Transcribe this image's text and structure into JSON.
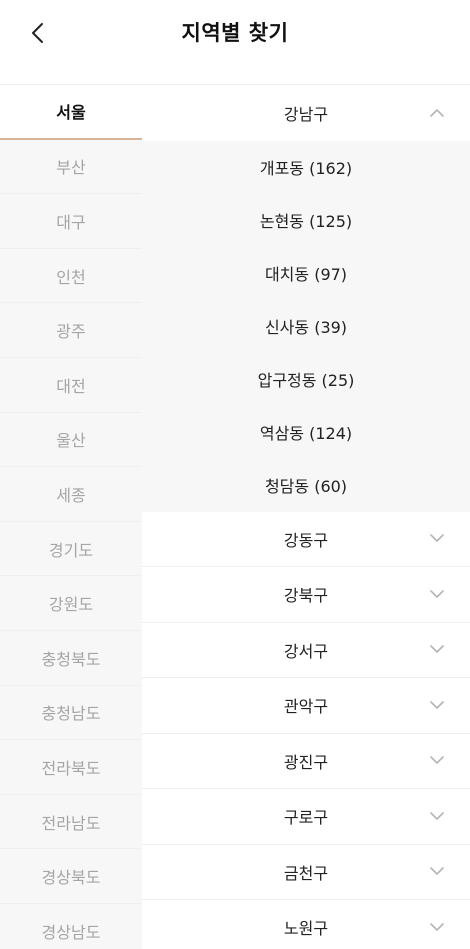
{
  "header": {
    "title": "지역별 찾기",
    "back_icon": "chevron-left-icon"
  },
  "regions": [
    {
      "label": "서울",
      "active": true
    },
    {
      "label": "부산"
    },
    {
      "label": "대구"
    },
    {
      "label": "인천"
    },
    {
      "label": "광주"
    },
    {
      "label": "대전"
    },
    {
      "label": "울산"
    },
    {
      "label": "세종"
    },
    {
      "label": "경기도"
    },
    {
      "label": "강원도"
    },
    {
      "label": "충청북도"
    },
    {
      "label": "충청남도"
    },
    {
      "label": "전라북도"
    },
    {
      "label": "전라남도"
    },
    {
      "label": "경상북도"
    },
    {
      "label": "경상남도"
    }
  ],
  "expanded_district": {
    "label": "강남구",
    "icon": "chevron-up-icon",
    "neighborhoods": [
      "개포동 (162)",
      "논현동 (125)",
      "대치동 (97)",
      "신사동 (39)",
      "압구정동 (25)",
      "역삼동 (124)",
      "청담동 (60)"
    ]
  },
  "districts": [
    {
      "label": "강동구"
    },
    {
      "label": "강북구"
    },
    {
      "label": "강서구"
    },
    {
      "label": "관악구"
    },
    {
      "label": "광진구"
    },
    {
      "label": "구로구"
    },
    {
      "label": "금천구"
    },
    {
      "label": "노원구"
    }
  ],
  "colors": {
    "active_underline": "#d8b49a",
    "sidebar_bg": "#f7f7f7",
    "inactive_text": "#a5a5a5"
  }
}
